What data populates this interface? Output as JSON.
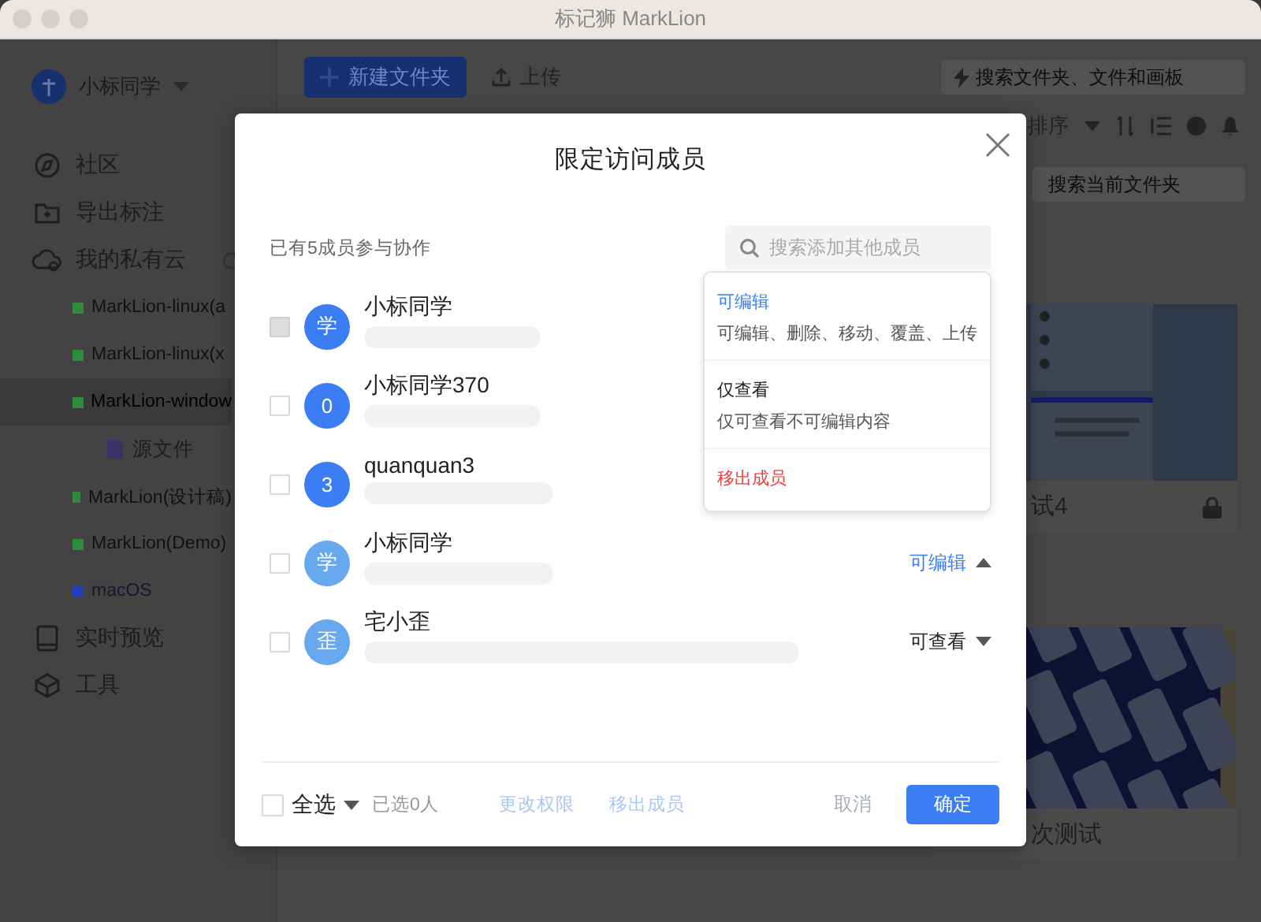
{
  "window": {
    "title": "标记狮 MarkLion"
  },
  "sidebar": {
    "user": {
      "name": "小标同学"
    },
    "items": [
      {
        "label": "社区",
        "kind": "compass"
      },
      {
        "label": "导出标注",
        "kind": "folder"
      },
      {
        "label": "我的私有云",
        "kind": "cloud",
        "children": [
          {
            "label": "MarkLion-linux(a",
            "color": "#2f8a3e",
            "selected": false,
            "disabled": false
          },
          {
            "label": "MarkLion-linux(x",
            "color": "#2f8a3e",
            "selected": false,
            "disabled": false
          },
          {
            "label": "MarkLion-window",
            "color": "#2f8a3e",
            "selected": true,
            "disabled": false,
            "children": [
              {
                "label": "源文件",
                "kind": "doc"
              }
            ]
          },
          {
            "label": "MarkLion(设计稿)",
            "color": "#2f8a3e",
            "selected": false,
            "disabled": false
          },
          {
            "label": "MarkLion(Demo)",
            "color": "#2f8a3e",
            "selected": false,
            "disabled": false
          },
          {
            "label": "macOS",
            "color": "#2440b8",
            "selected": false,
            "disabled": true
          }
        ]
      },
      {
        "label": "实时预览",
        "kind": "tablet"
      },
      {
        "label": "工具",
        "kind": "cube"
      }
    ]
  },
  "toolbar": {
    "new_folder": "新建文件夹",
    "upload": "上传",
    "search": {
      "placeholder": "搜索文件夹、文件和画板"
    },
    "sort": "排序",
    "folder_search": {
      "placeholder": "搜索当前文件夹"
    }
  },
  "cards": [
    {
      "title": "试4",
      "locked": true
    },
    {
      "title": "次测试",
      "locked": false
    }
  ],
  "dialog": {
    "title": "限定访问成员",
    "member_count": "已有5成员参与协作",
    "search": {
      "placeholder": "搜索添加其他成员"
    },
    "members": [
      {
        "avatar": "学",
        "name": "小标同学",
        "color": "#3b7df4",
        "checked": false,
        "disabled": true
      },
      {
        "avatar": "0",
        "name": "小标同学370",
        "color": "#3b7df4",
        "checked": false,
        "disabled": false
      },
      {
        "avatar": "3",
        "name": "quanquan3",
        "color": "#3b7df4",
        "checked": false,
        "disabled": false
      },
      {
        "avatar": "学",
        "name": "小标同学",
        "color": "#67a8ee",
        "checked": false,
        "disabled": false,
        "permission": {
          "label": "可编辑",
          "expanded": true
        }
      },
      {
        "avatar": "歪",
        "name": "宅小歪",
        "color": "#67a8ee",
        "checked": false,
        "disabled": false,
        "permission": {
          "label": "可查看",
          "expanded": false
        }
      }
    ],
    "menu": [
      {
        "label": "可编辑",
        "description": "可编辑、删除、移动、覆盖、上传",
        "selected": true,
        "kind": "option"
      },
      {
        "label": "仅查看",
        "description": "仅可查看不可编辑内容",
        "selected": false,
        "kind": "option"
      },
      {
        "label": "移出成员",
        "selected": false,
        "kind": "danger"
      }
    ],
    "footer": {
      "select_all": {
        "label": "全选",
        "checked": false
      },
      "selected_count": "已选0人",
      "actions": [
        {
          "label": "更改权限",
          "disabled": true
        },
        {
          "label": "移出成员",
          "disabled": true
        }
      ],
      "cancel": "取消",
      "confirm": "确定"
    }
  }
}
